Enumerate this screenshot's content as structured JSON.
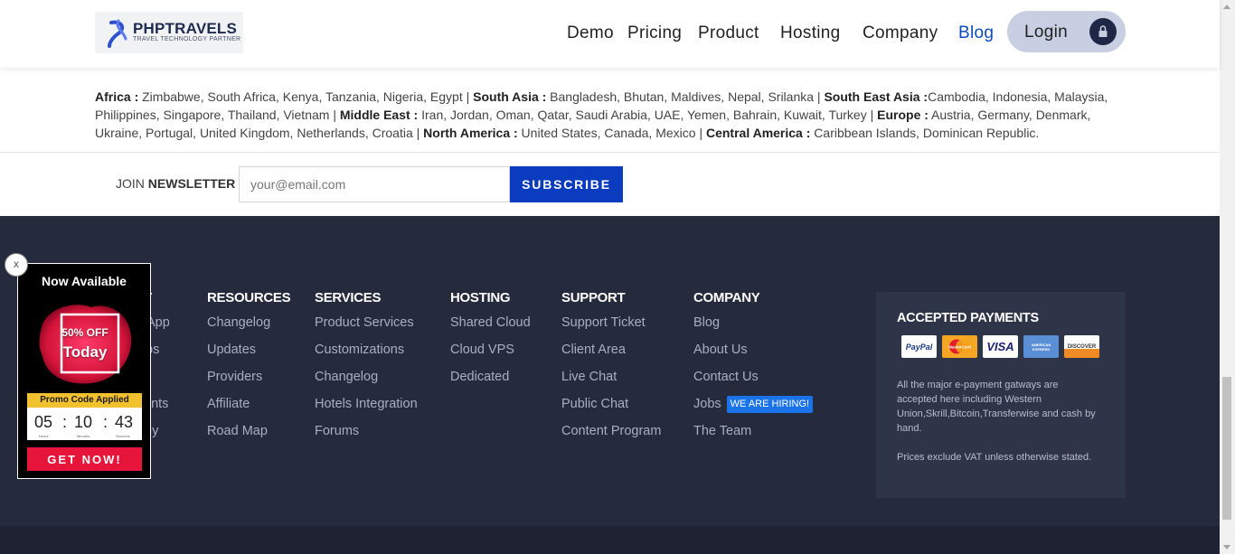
{
  "header": {
    "brand": "PHPTRAVELS",
    "tagline": "TRAVEL TECHNOLOGY PARTNER",
    "nav": [
      "Demo",
      "Pricing",
      "Product",
      "Hosting",
      "Company",
      "Blog"
    ],
    "login_label": "Login"
  },
  "regions": [
    {
      "name": "Africa :",
      "countries": " Zimbabwe, South Africa, Kenya, Tanzania, Nigeria, Egypt | "
    },
    {
      "name": "South Asia :",
      "countries": " Bangladesh, Bhutan, Maldives, Nepal, Srilanka | "
    },
    {
      "name": "South East Asia :",
      "countries": "Cambodia, Indonesia, Malaysia, Philippines, Singapore, Thailand, Vietnam | "
    },
    {
      "name": "Middle East :",
      "countries": " Iran, Jordan, Oman, Qatar, Saudi Arabia, UAE, Yemen, Bahrain, Kuwait, Turkey | "
    },
    {
      "name": "Europe :",
      "countries": " Austria, Germany, Denmark, Ukraine, Portugal, United Kingdom, Netherlands, Croatia | "
    },
    {
      "name": "North America :",
      "countries": " United States, Canada, Mexico | "
    },
    {
      "name": "Central America :",
      "countries": " Caribbean Islands, Dominican Republic."
    }
  ],
  "newsletter": {
    "label_pre": "JOIN ",
    "label_bold": "NEWSLETTER",
    "placeholder": "your@email.com",
    "button": "SUBSCRIBE"
  },
  "footer": {
    "columns": [
      {
        "heading": "T",
        "items": [
          "App",
          "ps",
          "",
          "ents",
          "gy"
        ]
      },
      {
        "heading": "RESOURCES",
        "items": [
          "Changelog",
          "Updates",
          "Providers",
          "Affiliate",
          "Road Map"
        ]
      },
      {
        "heading": "SERVICES",
        "items": [
          "Product Services",
          "Customizations",
          "Changelog",
          "Hotels Integration",
          "Forums"
        ]
      },
      {
        "heading": "HOSTING",
        "items": [
          "Shared Cloud",
          "Cloud VPS",
          "Dedicated"
        ]
      },
      {
        "heading": "SUPPORT",
        "items": [
          "Support Ticket",
          "Client Area",
          "Live Chat",
          "Public Chat",
          "Content Program"
        ]
      },
      {
        "heading": "COMPANY",
        "items": [
          "Blog",
          "About Us",
          "Contact Us",
          "Jobs",
          "The Team"
        ]
      }
    ],
    "hiring_badge": "WE ARE HIRING!",
    "payments": {
      "heading": "ACCEPTED PAYMENTS",
      "cards": [
        "PayPal",
        "MasterCard",
        "VISA",
        "AMERICAN EXPRESS",
        "DISCOVER"
      ],
      "text1": "All the major e-payment gatways are accepted here including Western Union,Skrill,Bitcoin,Transferwise and cash by hand.",
      "text2": "Prices exclude VAT unless otherwise stated."
    }
  },
  "promo": {
    "title": "Now Available",
    "discount": "50% OFF",
    "today": "Today",
    "code_label": "Promo Code Applied",
    "hours": "05",
    "minutes": "10",
    "seconds": "43",
    "hours_label": "Hours",
    "minutes_label": "Minutes",
    "seconds_label": "Seconds",
    "cta": "GET NOW!",
    "close": "x"
  },
  "colors": {
    "accent": "#0b3cbf",
    "footer_bg": "#252a3d",
    "promo_red": "#e8153a",
    "hiring_blue": "#1a73e8"
  }
}
